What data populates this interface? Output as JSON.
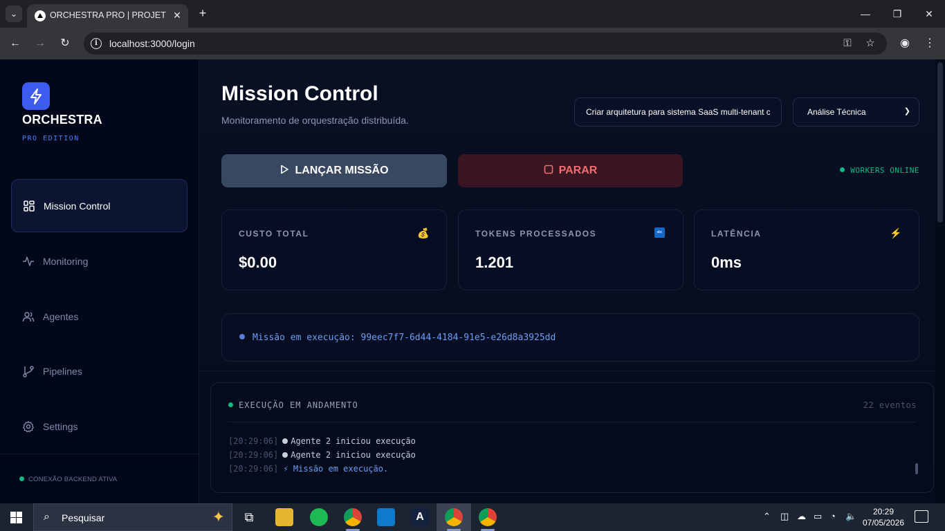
{
  "browser": {
    "tab_title": "ORCHESTRA PRO | PROJETO PO",
    "url": "localhost:3000/login"
  },
  "sidebar": {
    "brand": "ORCHESTRA",
    "edition": "PRO EDITION",
    "items": [
      {
        "label": "Mission Control",
        "icon": "grid-icon",
        "active": true
      },
      {
        "label": "Monitoring",
        "icon": "activity-icon"
      },
      {
        "label": "Agentes",
        "icon": "users-icon"
      },
      {
        "label": "Pipelines",
        "icon": "git-branch-icon"
      },
      {
        "label": "Settings",
        "icon": "gear-icon"
      }
    ],
    "connection_status": "CONEXÃO BACKEND ATIVA"
  },
  "header": {
    "title": "Mission Control",
    "subtitle": "Monitoramento de orquestração distribuída.",
    "prompt_value": "Criar arquitetura para sistema SaaS multi-tenant c",
    "mode_value": "Análise Técnica"
  },
  "actions": {
    "launch_label": "LANÇAR MISSÃO",
    "stop_label": "PARAR",
    "workers_status": "WORKERS ONLINE"
  },
  "metrics": [
    {
      "label": "CUSTO TOTAL",
      "value": "$0.00",
      "icon": "money-bag-icon"
    },
    {
      "label": "TOKENS PROCESSADOS",
      "value": "1.201",
      "icon": "abc-icon"
    },
    {
      "label": "LATÊNCIA",
      "value": "0ms",
      "icon": "lightning-icon"
    }
  ],
  "mission_status": "Missão em execução: 99eec7f7-6d44-4184-91e5-e26d8a3925dd",
  "log": {
    "title": "EXECUÇÃO EM ANDAMENTO",
    "count": "22 eventos",
    "entries": [
      {
        "time": "[20:29:06]",
        "text": "Agente 2 iniciou execução"
      },
      {
        "time": "[20:29:06]",
        "text": "Agente 2 iniciou execução"
      },
      {
        "time": "[20:29:06]",
        "text": "⚡ Missão em execução."
      }
    ]
  },
  "taskbar": {
    "search_placeholder": "Pesquisar",
    "time": "20:29",
    "date": "07/05/2026"
  },
  "colors": {
    "accent": "#3e5bef",
    "success": "#10b981",
    "danger": "#f26d6d",
    "info": "#6d9ef5"
  }
}
